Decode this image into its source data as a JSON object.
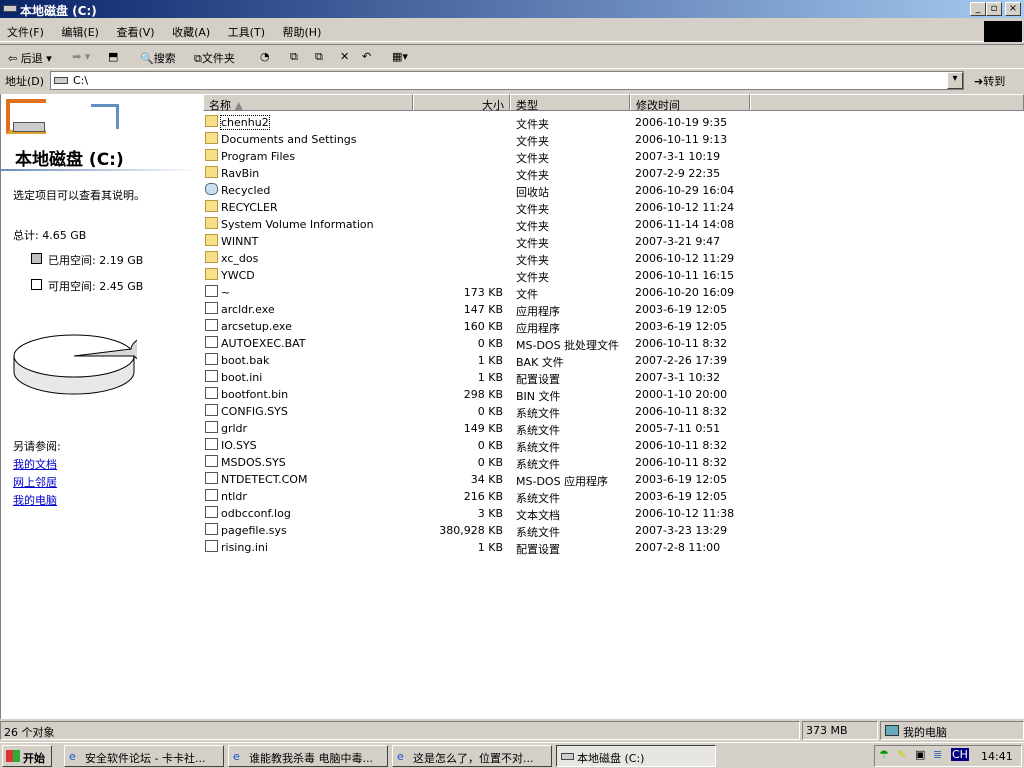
{
  "window": {
    "title": "本地磁盘 (C:)"
  },
  "menu": [
    "文件(F)",
    "编辑(E)",
    "查看(V)",
    "收藏(A)",
    "工具(T)",
    "帮助(H)"
  ],
  "toolbar": {
    "back": "后退",
    "search": "搜索",
    "folders": "文件夹"
  },
  "address": {
    "label": "地址(D)",
    "value": "C:\\",
    "go": "转到"
  },
  "left": {
    "title": "本地磁盘 (C:)",
    "hint": "选定项目可以查看其说明。",
    "total": "总计: 4.65 GB",
    "used": "已用空间: 2.19 GB",
    "free": "可用空间: 2.45 GB",
    "see_also": "另请参阅:",
    "links": [
      "我的文档",
      "网上邻居",
      "我的电脑"
    ]
  },
  "columns": [
    "名称",
    "大小",
    "类型",
    "修改时间"
  ],
  "files": [
    {
      "name": "chenhu2",
      "size": "",
      "type": "文件夹",
      "date": "2006-10-19 9:35",
      "kind": "folder"
    },
    {
      "name": "Documents and Settings",
      "size": "",
      "type": "文件夹",
      "date": "2006-10-11 9:13",
      "kind": "folder"
    },
    {
      "name": "Program Files",
      "size": "",
      "type": "文件夹",
      "date": "2007-3-1 10:19",
      "kind": "folder"
    },
    {
      "name": "RavBin",
      "size": "",
      "type": "文件夹",
      "date": "2007-2-9 22:35",
      "kind": "folder"
    },
    {
      "name": "Recycled",
      "size": "",
      "type": "回收站",
      "date": "2006-10-29 16:04",
      "kind": "recycle"
    },
    {
      "name": "RECYCLER",
      "size": "",
      "type": "文件夹",
      "date": "2006-10-12 11:24",
      "kind": "folder"
    },
    {
      "name": "System Volume Information",
      "size": "",
      "type": "文件夹",
      "date": "2006-11-14 14:08",
      "kind": "folder"
    },
    {
      "name": "WINNT",
      "size": "",
      "type": "文件夹",
      "date": "2007-3-21 9:47",
      "kind": "folder"
    },
    {
      "name": "xc_dos",
      "size": "",
      "type": "文件夹",
      "date": "2006-10-12 11:29",
      "kind": "folder"
    },
    {
      "name": "YWCD",
      "size": "",
      "type": "文件夹",
      "date": "2006-10-11 16:15",
      "kind": "folder"
    },
    {
      "name": "~",
      "size": "173 KB",
      "type": "文件",
      "date": "2006-10-20 16:09",
      "kind": "file"
    },
    {
      "name": "arcldr.exe",
      "size": "147 KB",
      "type": "应用程序",
      "date": "2003-6-19 12:05",
      "kind": "file"
    },
    {
      "name": "arcsetup.exe",
      "size": "160 KB",
      "type": "应用程序",
      "date": "2003-6-19 12:05",
      "kind": "file"
    },
    {
      "name": "AUTOEXEC.BAT",
      "size": "0 KB",
      "type": "MS-DOS 批处理文件",
      "date": "2006-10-11 8:32",
      "kind": "file"
    },
    {
      "name": "boot.bak",
      "size": "1 KB",
      "type": "BAK 文件",
      "date": "2007-2-26 17:39",
      "kind": "file"
    },
    {
      "name": "boot.ini",
      "size": "1 KB",
      "type": "配置设置",
      "date": "2007-3-1 10:32",
      "kind": "file"
    },
    {
      "name": "bootfont.bin",
      "size": "298 KB",
      "type": "BIN 文件",
      "date": "2000-1-10 20:00",
      "kind": "file"
    },
    {
      "name": "CONFIG.SYS",
      "size": "0 KB",
      "type": "系统文件",
      "date": "2006-10-11 8:32",
      "kind": "file"
    },
    {
      "name": "grldr",
      "size": "149 KB",
      "type": "系统文件",
      "date": "2005-7-11 0:51",
      "kind": "file"
    },
    {
      "name": "IO.SYS",
      "size": "0 KB",
      "type": "系统文件",
      "date": "2006-10-11 8:32",
      "kind": "file"
    },
    {
      "name": "MSDOS.SYS",
      "size": "0 KB",
      "type": "系统文件",
      "date": "2006-10-11 8:32",
      "kind": "file"
    },
    {
      "name": "NTDETECT.COM",
      "size": "34 KB",
      "type": "MS-DOS 应用程序",
      "date": "2003-6-19 12:05",
      "kind": "file"
    },
    {
      "name": "ntldr",
      "size": "216 KB",
      "type": "系统文件",
      "date": "2003-6-19 12:05",
      "kind": "file"
    },
    {
      "name": "odbcconf.log",
      "size": "3 KB",
      "type": "文本文档",
      "date": "2006-10-12 11:38",
      "kind": "file"
    },
    {
      "name": "pagefile.sys",
      "size": "380,928 KB",
      "type": "系统文件",
      "date": "2007-3-23 13:29",
      "kind": "file"
    },
    {
      "name": "rising.ini",
      "size": "1 KB",
      "type": "配置设置",
      "date": "2007-2-8 11:00",
      "kind": "file"
    }
  ],
  "status": {
    "count": "26 个对象",
    "size": "373 MB",
    "location": "我的电脑"
  },
  "taskbar": {
    "start": "开始",
    "tasks": [
      "安全软件论坛 - 卡卡社...",
      "谁能教我杀毒 电脑中毒...",
      "这是怎么了，位置不对...",
      "本地磁盘 (C:)"
    ],
    "lang": "CH",
    "clock": "14:41"
  }
}
